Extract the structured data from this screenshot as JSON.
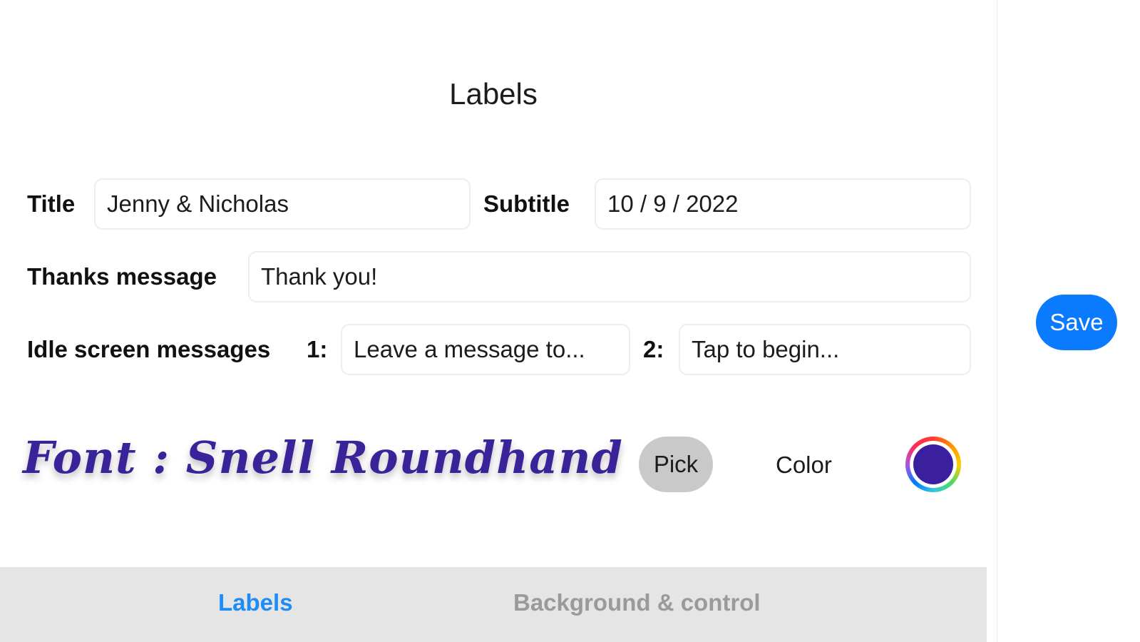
{
  "header": {
    "title": "Labels"
  },
  "form": {
    "title_label": "Title",
    "title_value": "Jenny & Nicholas",
    "subtitle_label": "Subtitle",
    "subtitle_value": "10 / 9 / 2022",
    "thanks_label": "Thanks message",
    "thanks_value": "Thank you!",
    "idle_label": "Idle screen messages",
    "idle_1_label": "1:",
    "idle_1_value": "Leave a message to...",
    "idle_2_label": "2:",
    "idle_2_value": "Tap to begin..."
  },
  "font": {
    "preview_text": "Font : Snell Roundhand",
    "pick_label": "Pick",
    "color_label": "Color",
    "selected_color": "#3a1f9e"
  },
  "tabs": [
    {
      "label": "Labels",
      "active": true,
      "color": "#1d8cf5"
    },
    {
      "label": "Background & control",
      "active": false,
      "color": "#9a9a9a"
    }
  ],
  "side": {
    "save_label": "Save",
    "save_color": "#0a7aff"
  }
}
